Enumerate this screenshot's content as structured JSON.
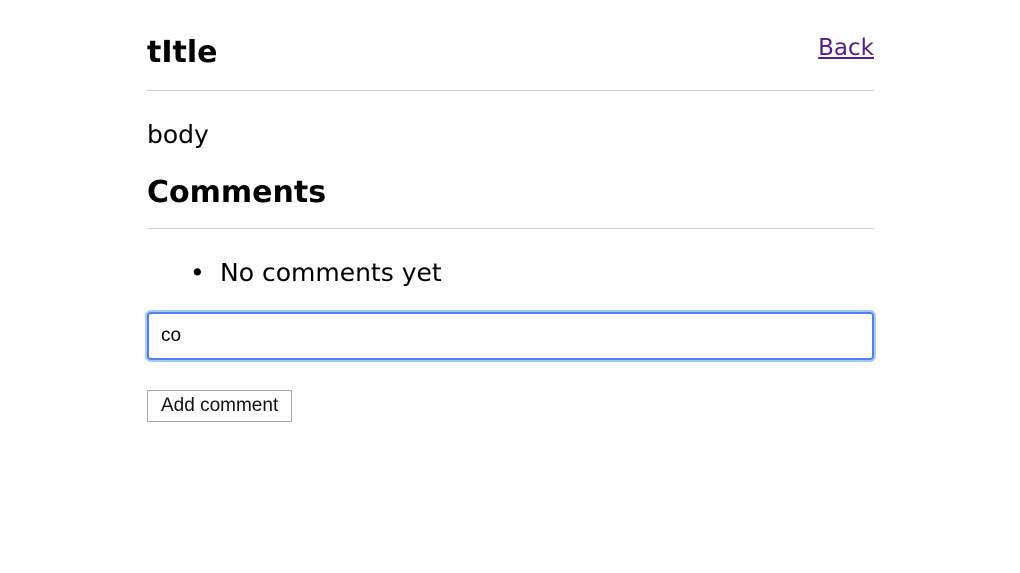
{
  "post": {
    "title": "tItle",
    "body": "body",
    "back_label": "Back"
  },
  "comments": {
    "heading": "Comments",
    "empty_message": "No comments yet",
    "bullet": "•"
  },
  "form": {
    "input_value": "co",
    "submit_label": "Add comment"
  },
  "colors": {
    "link": "#551a8b",
    "focus_ring": "#4a86e8",
    "divider": "#cfcfcf"
  }
}
